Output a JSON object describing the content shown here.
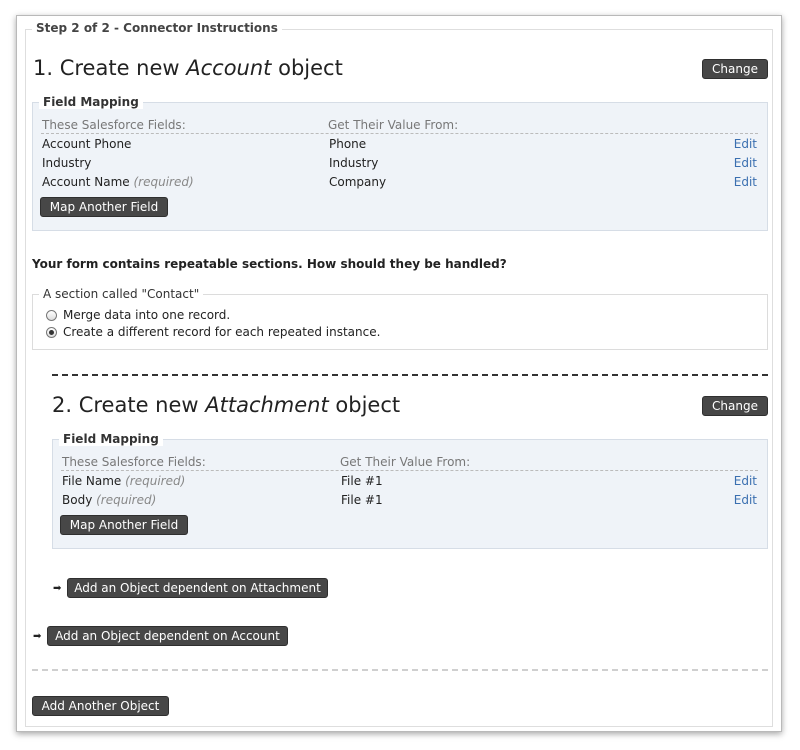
{
  "step": {
    "legend": "Step 2 of 2 - Connector Instructions"
  },
  "account": {
    "title_prefix": "1. Create new ",
    "title_object": "Account",
    "title_suffix": " object",
    "change_label": "Change",
    "mapping": {
      "legend": "Field Mapping",
      "col_salesforce": "These Salesforce Fields:",
      "col_value": "Get Their Value From:",
      "rows": [
        {
          "field": "Account Phone",
          "required": "",
          "value": "Phone",
          "edit": "Edit"
        },
        {
          "field": "Industry",
          "required": "",
          "value": "Industry",
          "edit": "Edit"
        },
        {
          "field": "Account Name",
          "required": "(required)",
          "value": "Company",
          "edit": "Edit"
        }
      ],
      "map_another_label": "Map Another Field"
    }
  },
  "repeatable": {
    "question": "Your form contains repeatable sections. How should they be handled?",
    "section_legend": "A section called \"Contact\"",
    "options": [
      {
        "label": "Merge data into one record.",
        "checked": false
      },
      {
        "label": "Create a different record for each repeated instance.",
        "checked": true
      }
    ]
  },
  "attachment": {
    "title_prefix": "2. Create new ",
    "title_object": "Attachment",
    "title_suffix": " object",
    "change_label": "Change",
    "mapping": {
      "legend": "Field Mapping",
      "col_salesforce": "These Salesforce Fields:",
      "col_value": "Get Their Value From:",
      "rows": [
        {
          "field": "File Name",
          "required": "(required)",
          "value": "File #1",
          "edit": "Edit"
        },
        {
          "field": "Body",
          "required": "(required)",
          "value": "File #1",
          "edit": "Edit"
        }
      ],
      "map_another_label": "Map Another Field"
    },
    "add_dependent_label": "Add an Object dependent on Attachment"
  },
  "account_add_dependent_label": "Add an Object dependent on Account",
  "add_another_object_label": "Add Another Object",
  "icons": {
    "arrow": "right-arrow-icon",
    "radio": "radio-icon"
  },
  "colors": {
    "button_bg": "#474747",
    "link": "#3a6fb0",
    "mapping_bg": "#eff3f8"
  }
}
